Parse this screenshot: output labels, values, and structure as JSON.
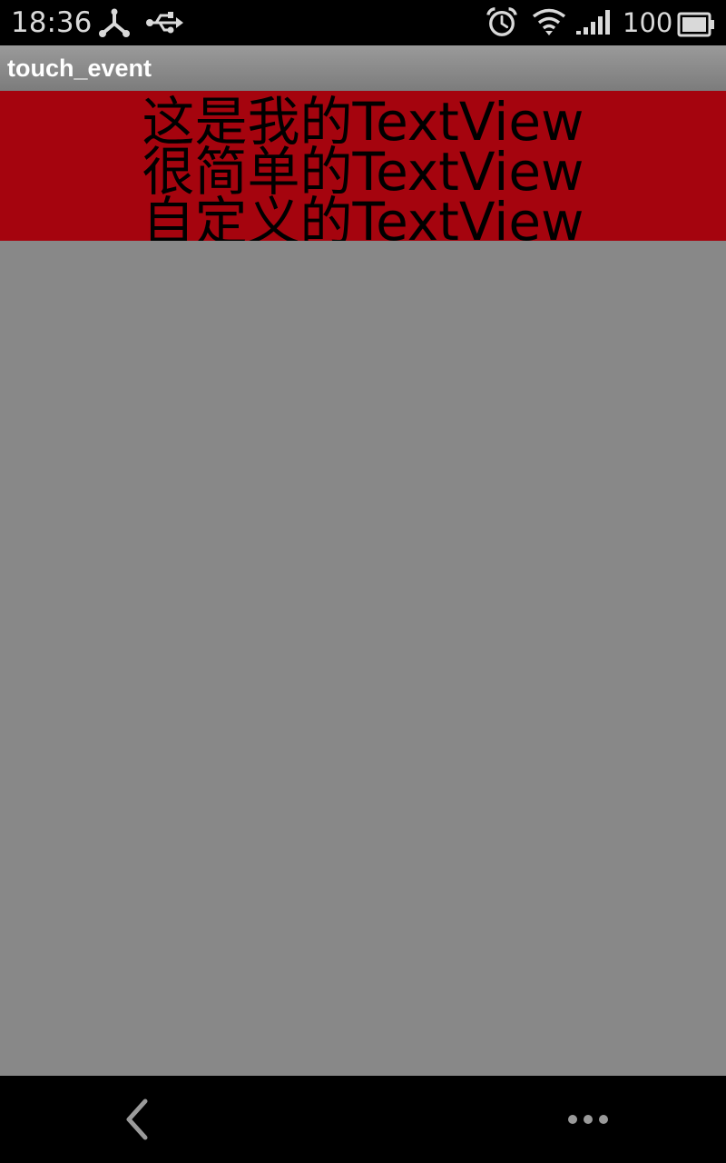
{
  "status_bar": {
    "time": "18:36",
    "battery_level": "100",
    "icons": [
      "nfc-share-icon",
      "usb-icon",
      "alarm-icon",
      "wifi-icon",
      "signal-icon",
      "battery-icon"
    ]
  },
  "title_bar": {
    "title": "touch_event"
  },
  "text_view": {
    "lines": [
      "这是我的TextView",
      "很简单的TextView",
      "自定义的TextView"
    ],
    "background_color": "#a5040e",
    "text_color": "#000000"
  },
  "nav_bar": {
    "icons": [
      "back-icon",
      "more-icon"
    ]
  },
  "colors": {
    "status_bar": "#000000",
    "content_background": "#888888",
    "status_text": "#d9d9d9"
  }
}
